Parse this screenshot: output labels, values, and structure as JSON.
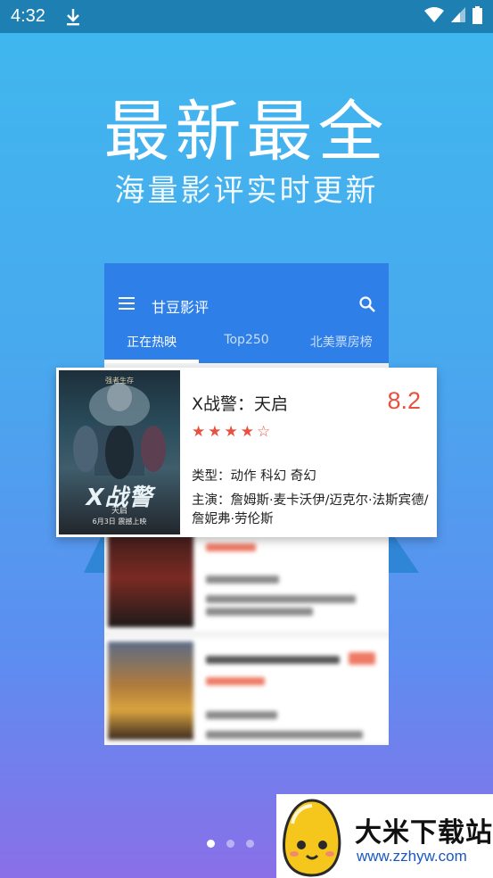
{
  "status_bar": {
    "time": "4:32"
  },
  "promo": {
    "headline": "最新最全",
    "subline": "海量影评实时更新"
  },
  "app": {
    "title": "甘豆影评",
    "tabs": [
      {
        "label": "正在热映"
      },
      {
        "label": "Top250"
      },
      {
        "label": "北美票房榜"
      }
    ]
  },
  "featured": {
    "title": "X战警：天启",
    "score": "8.2",
    "stars": "★★★★☆",
    "genre": "类型：动作 科幻 奇幻",
    "cast": "主演：詹姆斯·麦卡沃伊/迈克尔·法斯宾德/詹妮弗·劳伦斯",
    "poster": {
      "tagline": "强者生存",
      "title": "X战警",
      "subtitle": "天启",
      "date": "6月3日 震撼上映"
    }
  },
  "pagination": {
    "count": 3,
    "active": 0
  },
  "watermark": {
    "title": "大米下载站",
    "url": "www.zzhyw.com"
  },
  "colors": {
    "status_bar": "#1e7fb3",
    "toolbar": "#2e7fe8",
    "score": "#e8513f"
  }
}
